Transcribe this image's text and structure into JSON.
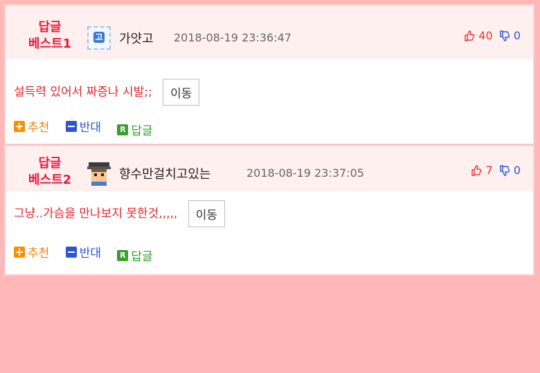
{
  "comments": [
    {
      "best_line1": "답글",
      "best_line2": "베스트1",
      "user_icon": "level-icon",
      "user_icon_text": "고",
      "nickname": "가얏고",
      "datetime": "2018-08-19 23:36:47",
      "upvotes": "40",
      "downvotes": "0",
      "content": "설득력 있어서 짜증나 시발;;",
      "move_label": "이동",
      "actions": {
        "recommend": "추천",
        "oppose": "반대",
        "reply": "답글"
      }
    },
    {
      "best_line1": "답글",
      "best_line2": "베스트2",
      "user_icon": "avatar-icon",
      "nickname": "향수만걸치고있는",
      "datetime": "2018-08-19 23:37:05",
      "upvotes": "7",
      "downvotes": "0",
      "content": "그냥..가슴을 만나보지 못한것,,,,,",
      "move_label": "이동",
      "actions": {
        "recommend": "추천",
        "oppose": "반대",
        "reply": "답글"
      }
    }
  ],
  "colors": {
    "page_bg": "#ffb8b8",
    "header_bg": "#fff0f0",
    "best_label": "#ea1a3c",
    "content_text": "#e3262d",
    "recommend": "#ff7a00",
    "oppose": "#2d54d6",
    "reply": "#2e9d23"
  }
}
